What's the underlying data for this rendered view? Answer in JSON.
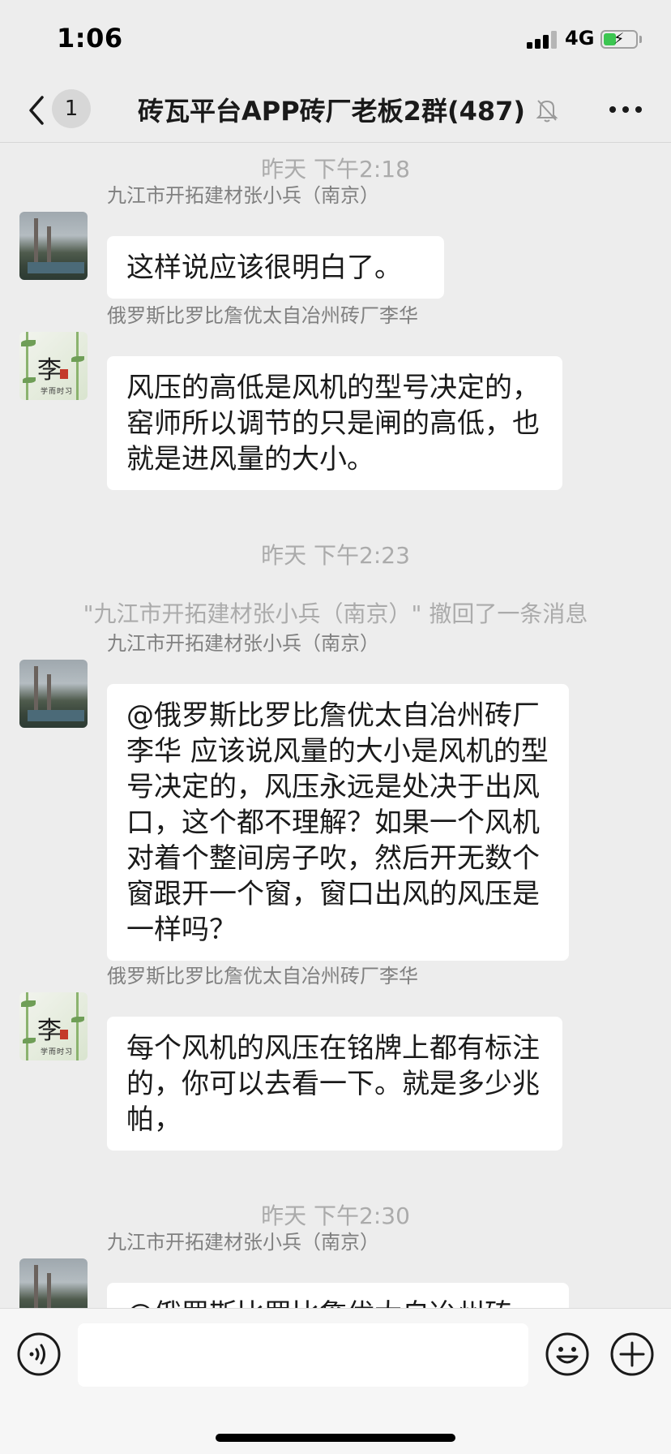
{
  "status_bar": {
    "time": "1:06",
    "network": "4G",
    "battery_level": 0.4,
    "battery_color": "#3cc651"
  },
  "nav": {
    "back_icon": "chevron-left-icon",
    "unread_count": "1",
    "title": "砖瓦平台APP砖厂老板2群(487)",
    "mute_icon": "bell-off-icon",
    "more_icon": "more-dots-icon"
  },
  "messages": {
    "ts1": "昨天 下午2:18",
    "m1": {
      "sender": "九江市开拓建材张小兵（南京）",
      "text": "这样说应该很明白了。"
    },
    "m2": {
      "sender": "俄罗斯比罗比詹优太自冶州砖厂李华",
      "text": "风压的高低是风机的型号决定的，窑师所以调节的只是闸的高低，也就是进风量的大小。"
    },
    "ts2": "昨天 下午2:23",
    "system": "\"九江市开拓建材张小兵（南京）\" 撤回了一条消息",
    "m3": {
      "sender": "九江市开拓建材张小兵（南京）",
      "text": "@俄罗斯比罗比詹优太自冶州砖厂李华 应该说风量的大小是风机的型号决定的，风压永远是处决于出风口，这个都不理解？如果一个风机对着个整间房子吹，然后开无数个窗跟开一个窗，窗口出风的风压是一样吗？"
    },
    "m4": {
      "sender": "俄罗斯比罗比詹优太自冶州砖厂李华",
      "text": "每个风机的风压在铭牌上都有标注的，你可以去看一下。就是多少兆帕，"
    },
    "ts3": "昨天 下午2:30",
    "m5": {
      "sender": "九江市开拓建材张小兵（南京）",
      "text": "@俄罗斯比罗比詹优太自冶州砖"
    },
    "avatar_bamboo_glyph": "李",
    "avatar_bamboo_caption": "学而时习"
  },
  "input_bar": {
    "voice_icon": "voice-icon",
    "emoji_icon": "emoji-icon",
    "plus_icon": "plus-icon",
    "input_value": ""
  },
  "colors": {
    "background": "#ededed",
    "bubble": "#ffffff",
    "meta_text": "#ababab",
    "sender_text": "#808080"
  }
}
